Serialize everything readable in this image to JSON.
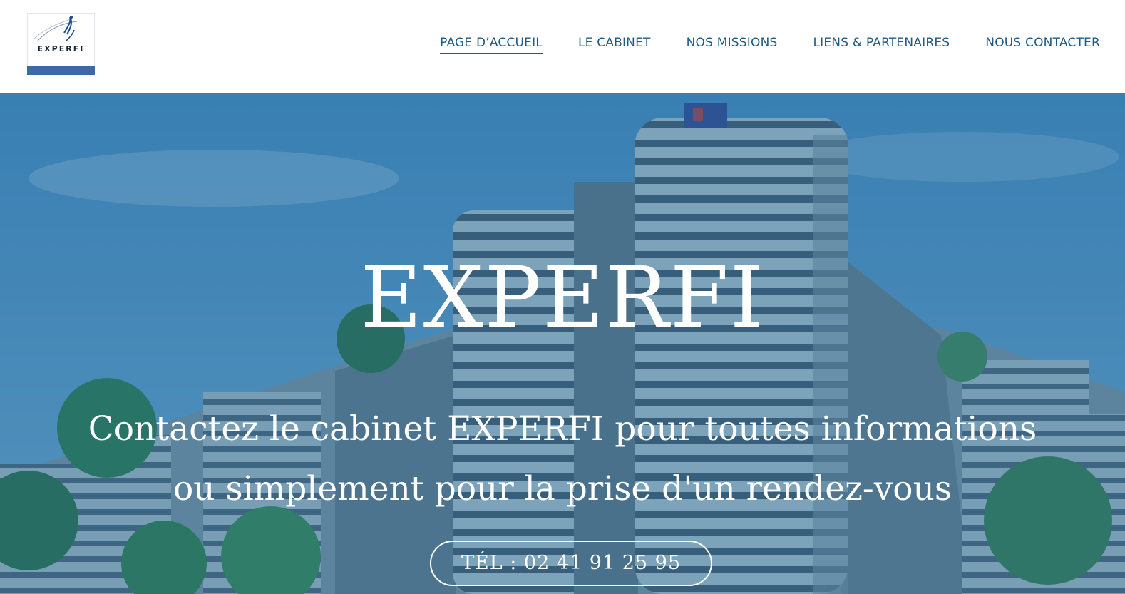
{
  "brand": {
    "logo_text": "EXPERFI",
    "colors": {
      "nav_text": "#1d5b84",
      "overlay": "#216d9d",
      "logo_bar": "#3c6aa6"
    }
  },
  "nav": {
    "items": [
      {
        "label": "PAGE D’ACCUEIL",
        "active": true
      },
      {
        "label": "LE CABINET"
      },
      {
        "label": "NOS MISSIONS"
      },
      {
        "label": "LIENS & PARTENAIRES"
      },
      {
        "label": "NOUS CONTACTER"
      }
    ]
  },
  "hero": {
    "title": "EXPERFI",
    "subtitle_line1": "Contactez le cabinet EXPERFI pour toutes informations",
    "subtitle_line2": "ou simplement pour la prise d'un rendez-vous",
    "cta_label": "TÉL : 02 41 91 25 95",
    "background_icon": "castle-photo"
  }
}
